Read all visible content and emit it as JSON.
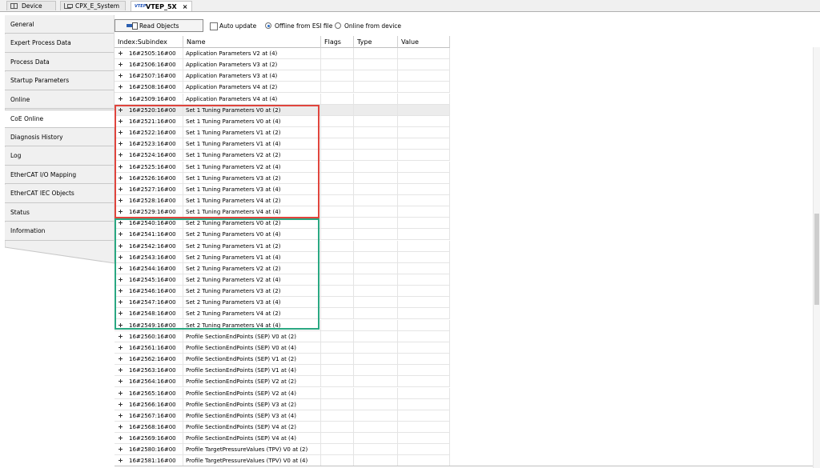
{
  "tabs": [
    {
      "label": "Device",
      "icon": "device-icon",
      "active": false
    },
    {
      "label": "CPX_E_System",
      "icon": "cpx-tree-icon",
      "active": false
    },
    {
      "label": "VTEP_5X",
      "icon": "vtep-logo-icon",
      "icon_text": "VTEP",
      "active": true,
      "close": "×"
    }
  ],
  "nav": [
    "General",
    "Expert Process Data",
    "Process Data",
    "Startup Parameters",
    "Online",
    "CoE Online",
    "Diagnosis History",
    "Log",
    "EtherCAT I/O Mapping",
    "EtherCAT IEC Objects",
    "Status",
    "Information"
  ],
  "nav_selected": 5,
  "toolbar": {
    "read_objects": "Read Objects",
    "auto_update": "Auto update",
    "auto_update_checked": false,
    "offline_esi": "Offline from ESI file",
    "online_device": "Online from device",
    "selected_source": "offline"
  },
  "columns": [
    "Index:Subindex",
    "Name",
    "Flags",
    "Type",
    "Value"
  ],
  "rows": [
    {
      "index": "16#2505:16#00",
      "name": "Application Parameters V2 at (4)"
    },
    {
      "index": "16#2506:16#00",
      "name": "Application Parameters V3 at (2)"
    },
    {
      "index": "16#2507:16#00",
      "name": "Application Parameters V3 at (4)"
    },
    {
      "index": "16#2508:16#00",
      "name": "Application Parameters V4 at (2)"
    },
    {
      "index": "16#2509:16#00",
      "name": "Application Parameters V4 at (4)"
    },
    {
      "index": "16#2520:16#00",
      "name": "Set 1 Tuning Parameters V0 at (2)"
    },
    {
      "index": "16#2521:16#00",
      "name": "Set 1 Tuning Parameters V0 at (4)"
    },
    {
      "index": "16#2522:16#00",
      "name": "Set 1 Tuning Parameters V1 at (2)"
    },
    {
      "index": "16#2523:16#00",
      "name": "Set 1 Tuning Parameters V1 at (4)"
    },
    {
      "index": "16#2524:16#00",
      "name": "Set 1 Tuning Parameters V2 at (2)"
    },
    {
      "index": "16#2525:16#00",
      "name": "Set 1 Tuning Parameters V2 at (4)"
    },
    {
      "index": "16#2526:16#00",
      "name": "Set 1 Tuning Parameters V3 at (2)"
    },
    {
      "index": "16#2527:16#00",
      "name": "Set 1 Tuning Parameters V3 at (4)"
    },
    {
      "index": "16#2528:16#00",
      "name": "Set 1 Tuning Parameters V4 at (2)"
    },
    {
      "index": "16#2529:16#00",
      "name": "Set 1 Tuning Parameters V4 at (4)"
    },
    {
      "index": "16#2540:16#00",
      "name": "Set 2 Tuning Parameters V0 at (2)"
    },
    {
      "index": "16#2541:16#00",
      "name": "Set 2 Tuning Parameters V0 at (4)"
    },
    {
      "index": "16#2542:16#00",
      "name": "Set 2 Tuning Parameters V1 at (2)"
    },
    {
      "index": "16#2543:16#00",
      "name": "Set 2 Tuning Parameters V1 at (4)"
    },
    {
      "index": "16#2544:16#00",
      "name": "Set 2 Tuning Parameters V2 at (2)"
    },
    {
      "index": "16#2545:16#00",
      "name": "Set 2 Tuning Parameters V2 at (4)"
    },
    {
      "index": "16#2546:16#00",
      "name": "Set 2 Tuning Parameters V3 at (2)"
    },
    {
      "index": "16#2547:16#00",
      "name": "Set 2 Tuning Parameters V3 at (4)"
    },
    {
      "index": "16#2548:16#00",
      "name": "Set 2 Tuning Parameters V4 at (2)"
    },
    {
      "index": "16#2549:16#00",
      "name": "Set 2 Tuning Parameters V4 at (4)"
    },
    {
      "index": "16#2560:16#00",
      "name": "Profile SectionEndPoints (SEP) V0 at (2)"
    },
    {
      "index": "16#2561:16#00",
      "name": "Profile SectionEndPoints (SEP) V0 at (4)"
    },
    {
      "index": "16#2562:16#00",
      "name": "Profile SectionEndPoints (SEP) V1 at (2)"
    },
    {
      "index": "16#2563:16#00",
      "name": "Profile SectionEndPoints (SEP) V1 at (4)"
    },
    {
      "index": "16#2564:16#00",
      "name": "Profile SectionEndPoints (SEP) V2 at (2)"
    },
    {
      "index": "16#2565:16#00",
      "name": "Profile SectionEndPoints (SEP) V2 at (4)"
    },
    {
      "index": "16#2566:16#00",
      "name": "Profile SectionEndPoints (SEP) V3 at (2)"
    },
    {
      "index": "16#2567:16#00",
      "name": "Profile SectionEndPoints (SEP) V3 at (4)"
    },
    {
      "index": "16#2568:16#00",
      "name": "Profile SectionEndPoints (SEP) V4 at (2)"
    },
    {
      "index": "16#2569:16#00",
      "name": "Profile SectionEndPoints (SEP) V4 at (4)"
    },
    {
      "index": "16#2580:16#00",
      "name": "Profile TargetPressureValues (TPV) V0 at (2)"
    },
    {
      "index": "16#2581:16#00",
      "name": "Profile TargetPressureValues (TPV) V0 at (4)"
    }
  ],
  "selected_row": 5,
  "highlight_colors": {
    "set1_box": "#e0453d",
    "set2_box": "#2aa882"
  }
}
